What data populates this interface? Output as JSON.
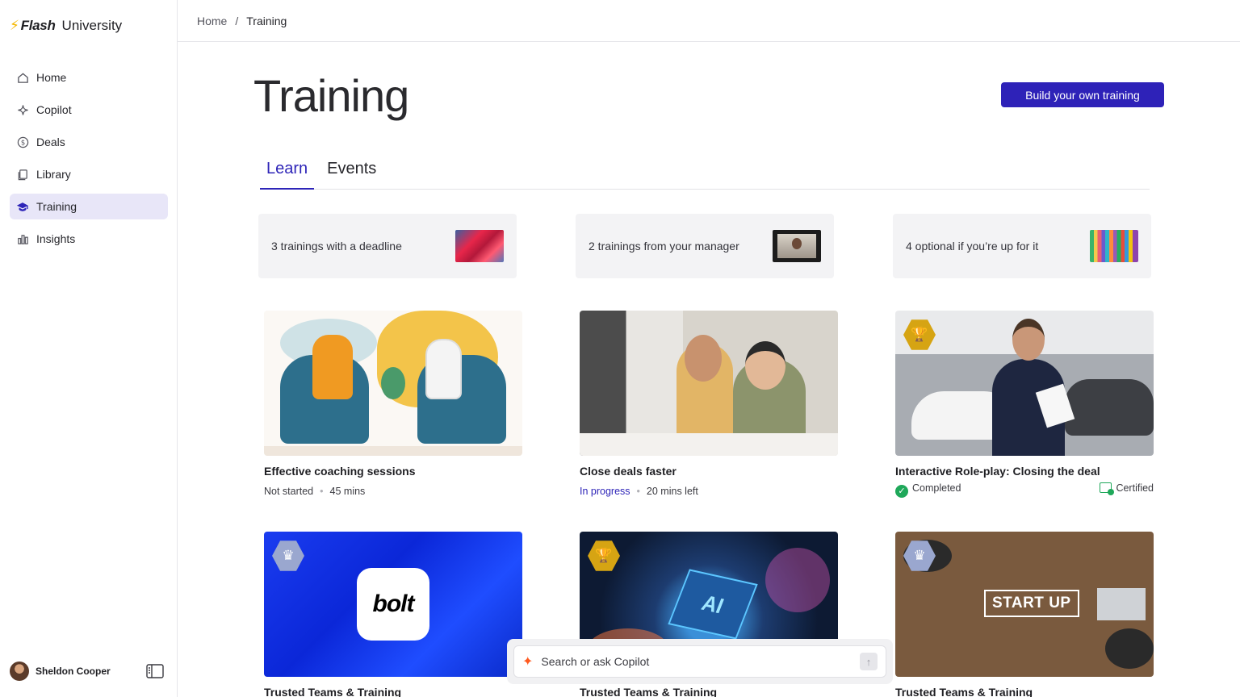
{
  "brand": {
    "name": "Flash",
    "suffix": "University"
  },
  "sidebar": {
    "items": [
      {
        "label": "Home",
        "icon": "home-icon"
      },
      {
        "label": "Copilot",
        "icon": "sparkle-icon"
      },
      {
        "label": "Deals",
        "icon": "dollar-icon"
      },
      {
        "label": "Library",
        "icon": "library-icon"
      },
      {
        "label": "Training",
        "icon": "graduation-cap-icon",
        "active": true
      },
      {
        "label": "Insights",
        "icon": "bar-chart-icon"
      }
    ],
    "user": "Sheldon Cooper"
  },
  "breadcrumb": {
    "home": "Home",
    "separator": "/",
    "current": "Training"
  },
  "page": {
    "title": "Training",
    "build_button": "Build your own training"
  },
  "tabs": [
    {
      "label": "Learn",
      "active": true
    },
    {
      "label": "Events"
    }
  ],
  "summaries": [
    {
      "label": "3 trainings with a deadline"
    },
    {
      "label": "2 trainings from your manager"
    },
    {
      "label": "4 optional if you’re up for it"
    }
  ],
  "cards": [
    {
      "title": "Effective coaching sessions",
      "status": "Not started",
      "duration": "45 mins"
    },
    {
      "title": "Close deals faster",
      "status": "In progress",
      "duration": "20 mins left"
    },
    {
      "title": "Interactive Role-play: Closing the deal",
      "status": "Completed",
      "cert": "Certified",
      "badge": "trophy-icon"
    },
    {
      "title": "Trusted Teams & Training",
      "logo": "bolt",
      "badge": "crown-icon"
    },
    {
      "title": "Trusted Teams & Training",
      "image_text": "AI",
      "badge": "trophy-icon"
    },
    {
      "title": "Trusted Teams & Training",
      "image_text": "START UP",
      "badge": "crown-icon"
    }
  ],
  "copilot": {
    "placeholder": "Search or ask Copilot"
  },
  "colors": {
    "accent": "#2e22b8",
    "active_nav_bg": "#e8e6f8",
    "completed": "#1fa85a",
    "brand_bolt": "#f5b800"
  }
}
